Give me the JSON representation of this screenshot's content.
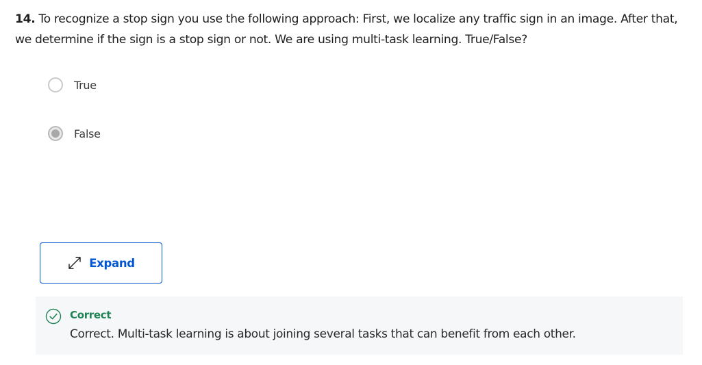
{
  "question": {
    "number": "14.",
    "text": "To recognize a stop sign you use the following approach:  First, we localize any traffic sign in an image. After that, we determine if the sign is a stop sign or not. We are using multi-task learning. True/False?"
  },
  "options": [
    {
      "label": "True",
      "selected": false
    },
    {
      "label": "False",
      "selected": true
    }
  ],
  "expand_button": {
    "label": "Expand",
    "icon": "expand-arrows-icon"
  },
  "feedback": {
    "status": "Correct",
    "icon": "check-circle-icon",
    "message": "Correct. Multi-task learning is about joining several tasks that can benefit from each other."
  },
  "colors": {
    "accent": "#0056d2",
    "success": "#1f8354",
    "feedback_bg": "#f5f7f8"
  }
}
